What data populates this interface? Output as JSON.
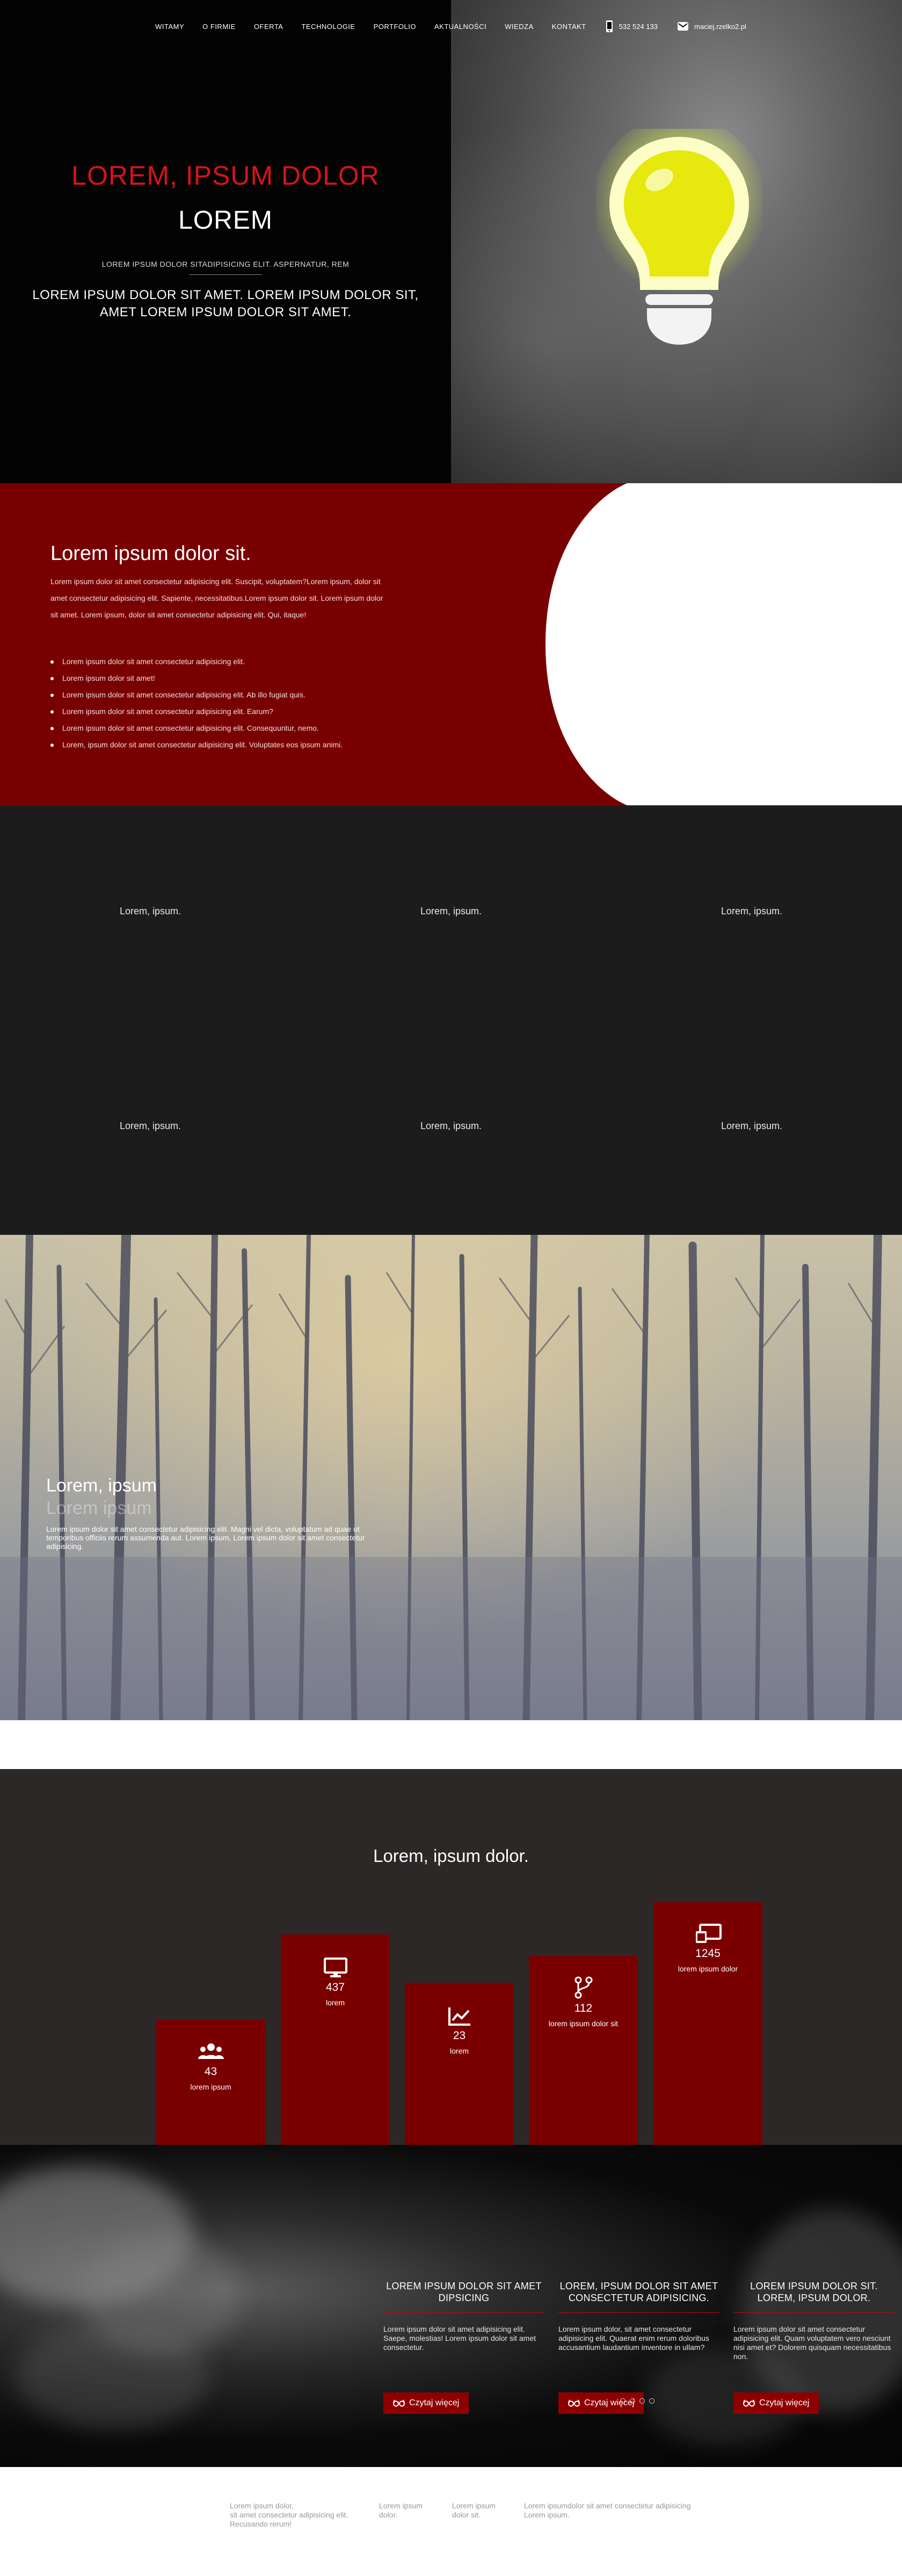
{
  "nav": {
    "links": [
      "WITAMY",
      "O FIRMIE",
      "OFERTA",
      "TECHNOLOGIE",
      "PORTFOLIO",
      "AKTUALNOŚCI",
      "WIEDZA",
      "KONTAKT"
    ],
    "phone": "532 524 133",
    "email": "maciej.rzelko2.pl",
    "phone_icon": "mobile-phone-icon",
    "email_icon": "envelope-icon"
  },
  "hero": {
    "title_red": "LOREM, IPSUM DOLOR",
    "title_white": "LOREM",
    "small": "LOREM IPSUM DOLOR SITADIPISICING ELIT. ASPERNATUR, REM",
    "big_line1": "LOREM IPSUM DOLOR SIT AMET. LOREM IPSUM DOLOR SIT,",
    "big_line2": "AMET LOREM IPSUM DOLOR SIT AMET.",
    "image_icon": "lightbulb-icon"
  },
  "intro": {
    "title": "Lorem ipsum dolor sit.",
    "paragraph": "Lorem ipsum dolor sit amet consectetur adipisicing elit. Suscipit, voluptatem?Lorem ipsum, dolor sit amet consectetur adipisicing elit. Sapiente, necessitatibus.Lorem ipsum dolor sit. Lorem ipsum dolor sit amet. Lorem ipsum, dolor sit amet consectetur adipisicing elit. Qui, itaque!",
    "list": [
      "Lorem ipsum dolor sit amet consectetur adipisicing elit.",
      "Lorem ipsum dolor sit amet!",
      "Lorem ipsum dolor sit amet consectetur adipisicing elit. Ab illo fugiat quis.",
      "Lorem ipsum dolor sit amet consectetur adipisicing elit. Earum?",
      "Lorem ipsum dolor sit amet consectetur adipisicing elit. Consequuntur, nemo.",
      "Lorem, ipsum dolor sit amet consectetur adipisicing elit. Voluptates eos ipsum animi."
    ]
  },
  "grid": {
    "labels": [
      "Lorem, ipsum.",
      "Lorem, ipsum.",
      "Lorem, ipsum.",
      "Lorem, ipsum.",
      "Lorem, ipsum.",
      "Lorem, ipsum."
    ]
  },
  "forest": {
    "title": "Lorem, ipsum",
    "subtitle": "Lorem ipsum",
    "text": "Lorem ipsum dolor sit amet consectetur adipisicing elit. Magni vel dicta, voluptatum ad quae ut temporibus officiis rerum assumenda aut. Lorem ipsum, Lorem ipsum dolor sit amet consectetur adipisicing."
  },
  "stats": {
    "title": "Lorem, ipsum dolor.",
    "items": [
      {
        "icon": "users-icon",
        "value": "43",
        "label": "lorem ipsum"
      },
      {
        "icon": "monitor-icon",
        "value": "437",
        "label": "lorem"
      },
      {
        "icon": "line-chart-icon",
        "value": "23",
        "label": "lorem"
      },
      {
        "icon": "code-branch-icon",
        "value": "112",
        "label": "lorem ipsum dolor sit"
      },
      {
        "icon": "laptop-icon",
        "value": "1245",
        "label": "lorem ipsum dolor"
      }
    ]
  },
  "news": {
    "items": [
      {
        "title": "LOREM IPSUM DOLOR SIT AMET DIPSICING",
        "text": "Lorem ipsum dolor sit amet adipisicing elit. Saepe, molestias! Lorem ipsum dolor sit amet consectetur.",
        "button": "Czytaj więcej"
      },
      {
        "title": "LOREM, IPSUM DOLOR SIT AMET CONSECTETUR ADIPISICING.",
        "text": "Lorem ipsum dolor, sit amet consectetur adipisicing elit. Quaerat enim rerum doloribus accusantium laudantium inventore in ullam?",
        "button": "Czytaj więcej"
      },
      {
        "title": "LOREM IPSUM DOLOR SIT. LOREM, IPSUM DOLOR.",
        "text": "Lorem ipsum dolor sit amet consectetur adipisicing elit. Quam voluptatem vero nesciunt nisi amet et? Dolorem quisquam necessitatibus non.",
        "button": "Czytaj więcej"
      }
    ],
    "button_icon": "glasses-icon",
    "carousel_dots": 4
  },
  "footer": {
    "col1_line1": "Lorem ipsum dolor,",
    "col1_line2": "sit amet consectetur adipisicing elit.",
    "col1_line3": "Recusando rerum!",
    "col2_line1": "Lorem ipsum",
    "col2_line2": "dolor.",
    "col3_line1": "Lorem ipsum",
    "col3_line2": "dolor sit.",
    "col4_line1": "Lorem ipsumdolor sit amet consectetur adipisicing",
    "col4_line2": "Lorem ipsum."
  },
  "colors": {
    "accent_red": "#790000",
    "title_red": "#d4141a",
    "dark": "#1c1c1c"
  }
}
